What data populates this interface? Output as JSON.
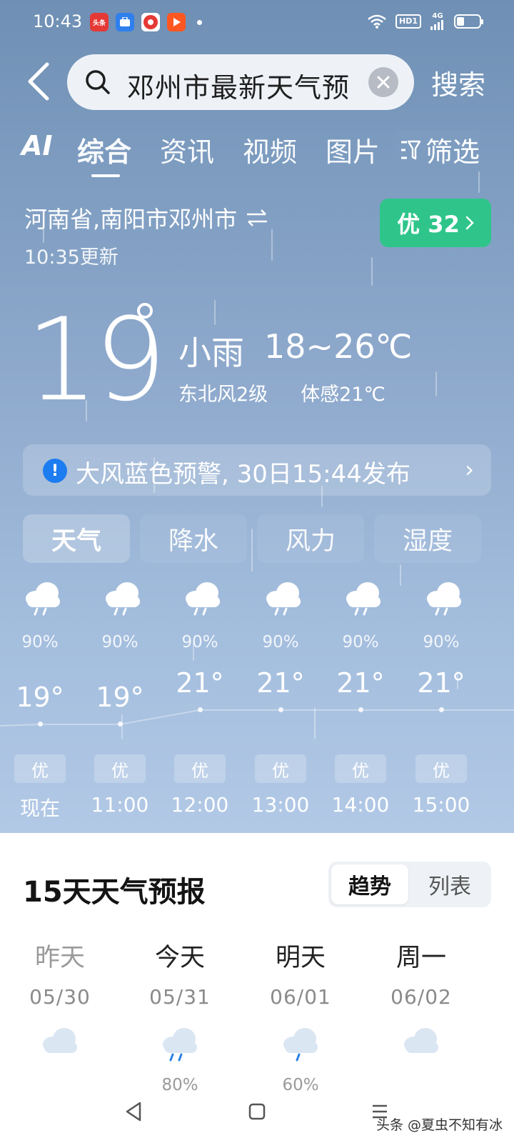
{
  "status_bar": {
    "time": "10:43",
    "app_badges": [
      {
        "name": "toutiao-app-icon",
        "label": "头条",
        "color": "#e53935"
      },
      {
        "name": "store-app-icon",
        "label": "",
        "color": "#2f80ed"
      },
      {
        "name": "music-app-icon",
        "label": "",
        "color": "#e53935"
      },
      {
        "name": "video-app-icon",
        "label": "",
        "color": "#ff5722"
      }
    ],
    "hd_label": "HD1",
    "network_label": "4G"
  },
  "search": {
    "query": "邓州市最新天气预",
    "button_label": "搜索"
  },
  "tabs": {
    "ai_label": "AI",
    "items": [
      "综合",
      "资讯",
      "视频",
      "图片"
    ],
    "active_index": 0,
    "filter_label": "筛选"
  },
  "weather": {
    "location": "河南省,南阳市邓州市",
    "updated": "10:35更新",
    "aqi_label": "优 32",
    "aqi_color": "#2fc58a",
    "current_temp": "19",
    "condition": "小雨",
    "temp_range": "18~26℃",
    "wind": "东北风2级",
    "feels_like": "体感21℃"
  },
  "warning": {
    "text": "大风蓝色预警, 30日15:44发布",
    "icon_color": "#1c7cf0"
  },
  "segment_tabs": {
    "items": [
      "天气",
      "降水",
      "风力",
      "湿度"
    ],
    "active_index": 0
  },
  "hourly": [
    {
      "time": "现在",
      "temp": "19°",
      "precip": "90%",
      "aq": "优",
      "temp_value": 19
    },
    {
      "time": "11:00",
      "temp": "19°",
      "precip": "90%",
      "aq": "优",
      "temp_value": 19
    },
    {
      "time": "12:00",
      "temp": "21°",
      "precip": "90%",
      "aq": "优",
      "temp_value": 21
    },
    {
      "time": "13:00",
      "temp": "21°",
      "precip": "90%",
      "aq": "优",
      "temp_value": 21
    },
    {
      "time": "14:00",
      "temp": "21°",
      "precip": "90%",
      "aq": "优",
      "temp_value": 21
    },
    {
      "time": "15:00",
      "temp": "21°",
      "precip": "90%",
      "aq": "优",
      "temp_value": 21
    }
  ],
  "forecast": {
    "title": "15天天气预报",
    "toggle": [
      "趋势",
      "列表"
    ],
    "toggle_active": 0,
    "days": [
      {
        "name": "昨天",
        "date": "05/30",
        "precip": "",
        "icon": "cloud-icon",
        "past": true
      },
      {
        "name": "今天",
        "date": "05/31",
        "precip": "80%",
        "icon": "rain-cloud-icon",
        "past": false
      },
      {
        "name": "明天",
        "date": "06/01",
        "precip": "60%",
        "icon": "light-rain-cloud-icon",
        "past": false
      },
      {
        "name": "周一",
        "date": "06/02",
        "precip": "",
        "icon": "cloud-icon",
        "past": false
      }
    ]
  },
  "watermark": "头条 @夏虫不知有冰"
}
